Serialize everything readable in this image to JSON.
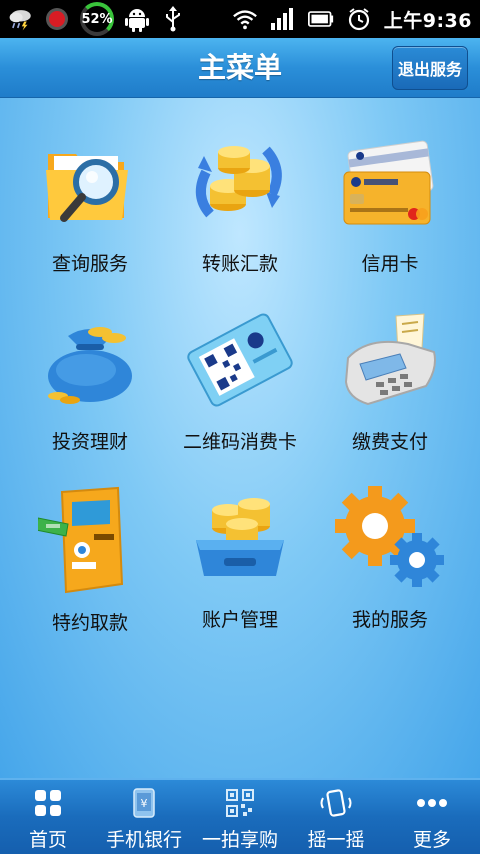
{
  "status_bar": {
    "battery_percent": "52%",
    "time": "上午9:36"
  },
  "header": {
    "title": "主菜单",
    "exit_label": "退出服务"
  },
  "menu": {
    "items": [
      {
        "label": "查询服务",
        "icon": "folder-magnifier-icon"
      },
      {
        "label": "转账汇款",
        "icon": "coins-transfer-icon"
      },
      {
        "label": "信用卡",
        "icon": "credit-card-icon"
      },
      {
        "label": "投资理财",
        "icon": "money-bag-icon"
      },
      {
        "label": "二维码消费卡",
        "icon": "qr-card-icon"
      },
      {
        "label": "缴费支付",
        "icon": "pos-terminal-icon"
      },
      {
        "label": "特约取款",
        "icon": "atm-icon"
      },
      {
        "label": "账户管理",
        "icon": "coin-tray-icon"
      },
      {
        "label": "我的服务",
        "icon": "gears-icon"
      }
    ]
  },
  "tabbar": {
    "tabs": [
      {
        "label": "首页",
        "icon": "home-grid-icon"
      },
      {
        "label": "手机银行",
        "icon": "mobile-bank-icon"
      },
      {
        "label": "一拍享购",
        "icon": "qr-scan-icon"
      },
      {
        "label": "摇一摇",
        "icon": "shake-icon"
      },
      {
        "label": "更多",
        "icon": "more-icon"
      }
    ]
  },
  "colors": {
    "title_bar": "#2b8fd9",
    "background_light": "#bfe7ff",
    "background_dark": "#46a6ea",
    "tab_bar": "#1a6cbc",
    "label_text": "#111111"
  }
}
